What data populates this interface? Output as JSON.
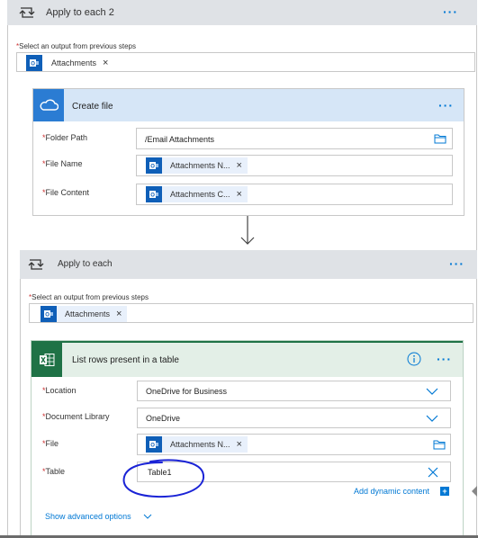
{
  "loop1": {
    "title": "Apply to each 2",
    "select_label": "Select an output from previous steps",
    "token_label": "Attachments"
  },
  "create_file": {
    "title": "Create file",
    "folder_path": {
      "label": "Folder Path",
      "value": "/Email Attachments"
    },
    "file_name": {
      "label": "File Name",
      "token": "Attachments N..."
    },
    "file_content": {
      "label": "File Content",
      "token": "Attachments C..."
    }
  },
  "loop2": {
    "title": "Apply to each",
    "select_label": "Select an output from previous steps",
    "token_label": "Attachments"
  },
  "list_rows": {
    "title": "List rows present in a table",
    "location": {
      "label": "Location",
      "value": "OneDrive for Business"
    },
    "document_library": {
      "label": "Document Library",
      "value": "OneDrive"
    },
    "file": {
      "label": "File",
      "token": "Attachments N..."
    },
    "table": {
      "label": "Table",
      "value": "Table1"
    },
    "add_dynamic_content": "Add dynamic content",
    "show_advanced": "Show advanced options"
  },
  "common": {
    "required_mark": "*",
    "remove_glyph": "×",
    "more_glyph": "···"
  },
  "colors": {
    "loop_header_bg": "#dfe2e6",
    "onedrive_header_bg": "#d6e6f7",
    "onedrive_blue": "#2b7cd3",
    "excel_header_bg": "#e3efe7",
    "excel_green": "#1f7246",
    "outlook_blue": "#0f5fb8",
    "link_blue": "#0078d4",
    "annotation_blue": "#1a23d6"
  }
}
